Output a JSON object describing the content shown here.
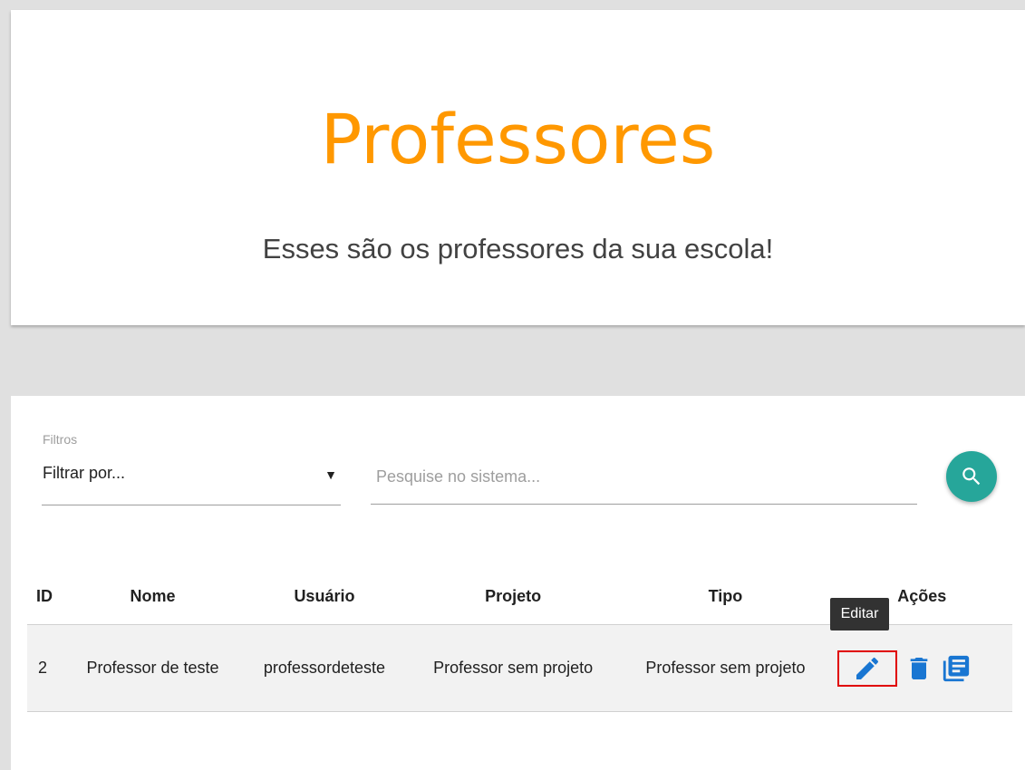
{
  "header": {
    "title": "Professores",
    "subtitle": "Esses são os professores da sua escola!"
  },
  "filters": {
    "label": "Filtros",
    "select_value": "Filtrar por...",
    "search_placeholder": "Pesquise no sistema...",
    "search_value": ""
  },
  "table": {
    "columns": [
      "ID",
      "Nome",
      "Usuário",
      "Projeto",
      "Tipo",
      "Ações"
    ],
    "rows": [
      {
        "id": "2",
        "nome": "Professor de teste",
        "usuario": "professordeteste",
        "projeto": "Professor sem projeto",
        "tipo": "Professor sem projeto"
      }
    ]
  },
  "actions": {
    "edit_tooltip": "Editar",
    "icons": [
      "edit-icon",
      "delete-icon",
      "details-icon"
    ]
  },
  "colors": {
    "title": "#ff9800",
    "search_button": "#26a69a",
    "action_icons": "#1976d2",
    "highlight": "#e00000"
  }
}
